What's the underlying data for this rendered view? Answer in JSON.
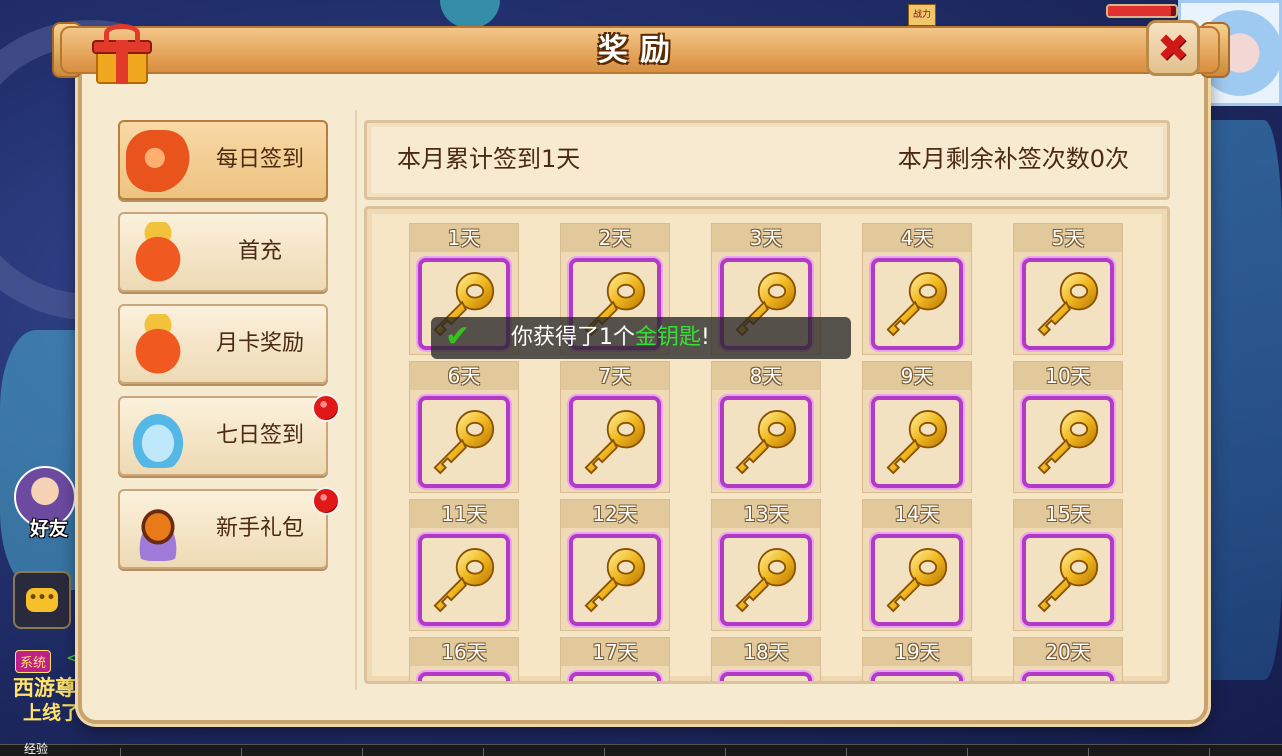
{
  "dialog": {
    "title": "奖励",
    "close_label": "✖"
  },
  "hud": {
    "friend_label": "好友",
    "chat_icon": "speech-bubble-icon",
    "system_badge": "系统",
    "system_line1": "西游尊",
    "system_line2": "上线了",
    "exp_label": "经验",
    "hp_fraction": 0.92,
    "top_badge": "战力"
  },
  "nav": {
    "items": [
      {
        "label": "每日签到",
        "icon": "lantern-icon",
        "active": true,
        "badge": false
      },
      {
        "label": "首充",
        "icon": "money-bag-icon",
        "active": false,
        "badge": false
      },
      {
        "label": "月卡奖励",
        "icon": "money-bag-icon",
        "active": false,
        "badge": false
      },
      {
        "label": "七日签到",
        "icon": "blue-bag-icon",
        "active": false,
        "badge": true
      },
      {
        "label": "新手礼包",
        "icon": "dragon-egg-icon",
        "active": false,
        "badge": true
      }
    ]
  },
  "stats": {
    "monthly_total": "本月累计签到1天",
    "remaining_makeup": "本月剩余补签次数0次"
  },
  "grid": {
    "days": [
      "1天",
      "2天",
      "3天",
      "4天",
      "5天",
      "6天",
      "7天",
      "8天",
      "9天",
      "10天",
      "11天",
      "12天",
      "13天",
      "14天",
      "15天",
      "16天",
      "17天",
      "18天",
      "19天",
      "20天"
    ],
    "item_icon": "gold-key-icon"
  },
  "toast": {
    "prefix": "你获得了1个",
    "item": "金钥匙",
    "suffix": "!"
  },
  "colors": {
    "panel_bg": "#f6ead1",
    "title_bar": "#e5a45a",
    "item_frame": "#b33ac4",
    "toast_highlight": "#35e035",
    "badge_red": "#e01818"
  }
}
